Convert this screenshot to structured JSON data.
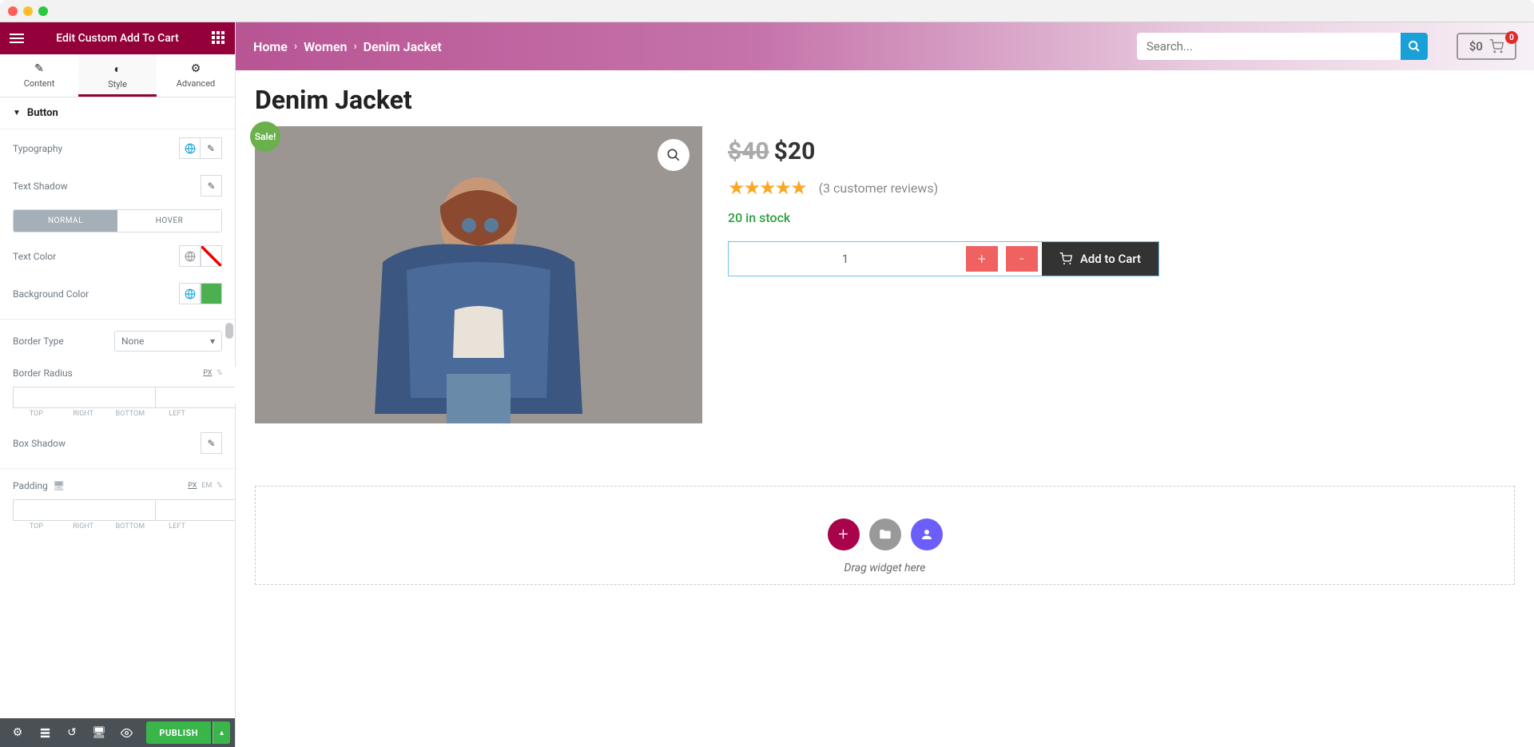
{
  "editor": {
    "title": "Edit Custom Add To Cart",
    "tabs": {
      "content": "Content",
      "style": "Style",
      "advanced": "Advanced"
    },
    "section": "Button",
    "rows": {
      "typography": "Typography",
      "text_shadow": "Text Shadow",
      "state_normal": "NORMAL",
      "state_hover": "HOVER",
      "text_color": "Text Color",
      "bg_color": "Background Color",
      "border_type": "Border Type",
      "border_type_value": "None",
      "border_radius": "Border Radius",
      "box_shadow": "Box Shadow",
      "padding": "Padding"
    },
    "dim_labels": {
      "top": "TOP",
      "right": "RIGHT",
      "bottom": "BOTTOM",
      "left": "LEFT"
    },
    "units": {
      "px": "PX",
      "pct": "%",
      "em": "EM"
    },
    "publish": "PUBLISH",
    "colors": {
      "bg_color": "#4caf50"
    }
  },
  "breadcrumb": {
    "home": "Home",
    "women": "Women",
    "product": "Denim Jacket"
  },
  "search": {
    "placeholder": "Search..."
  },
  "cart": {
    "total": "$0",
    "badge": "0"
  },
  "product": {
    "title": "Denim Jacket",
    "sale_badge": "Sale!",
    "old_price": "$40",
    "price": "$20",
    "reviews": "(3 customer reviews)",
    "stock": "20 in stock",
    "qty": "1",
    "plus": "+",
    "minus": "-",
    "add_to_cart": "Add to Cart"
  },
  "dropzone": {
    "text": "Drag widget here"
  }
}
